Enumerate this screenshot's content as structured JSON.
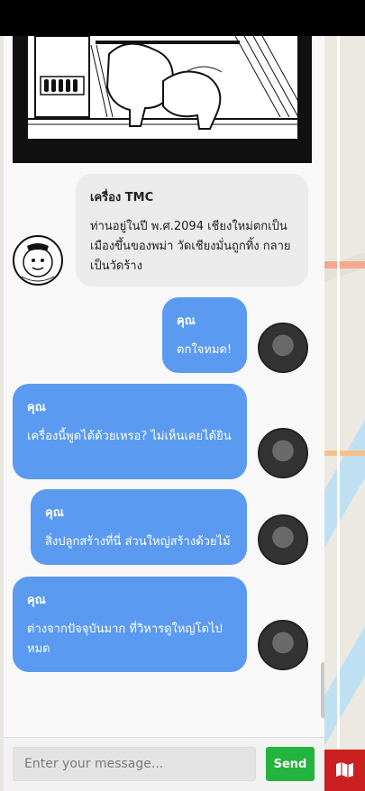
{
  "chat": {
    "messages": [
      {
        "sender": "เครื่อง TMC",
        "role": "bot",
        "text": "ท่านอยู่ในปี พ.ศ.2094 เชียงใหม่ตกเป็นเมืองขึ้นของพม่า วัดเชียงมั่นถูกทิ้ง กลายเป็นวัดร้าง"
      },
      {
        "sender": "คุณ",
        "role": "user",
        "text": "ตกใจหมด!"
      },
      {
        "sender": "คุณ",
        "role": "user",
        "text": "เครื่องนี้พูดได้ด้วยเหรอ? ไม่เห็นเคยได้ยิน"
      },
      {
        "sender": "คุณ",
        "role": "user",
        "text": "สิ่งปลูกสร้างที่นี่ ส่วนใหญ่สร้างด้วยไม้"
      },
      {
        "sender": "คุณ",
        "role": "user",
        "text": "ต่างจากปัจจุบันมาก ที่วิหารดูใหญ่โตไปหมด"
      }
    ]
  },
  "composer": {
    "placeholder": "Enter your message...",
    "send_label": "Send"
  },
  "colors": {
    "user_bubble": "#5a9af1",
    "bot_bubble": "#ebebeb",
    "send_button": "#22b43c",
    "map_button": "#cc1f1f"
  },
  "icons": {
    "map_button": "map-icon"
  }
}
